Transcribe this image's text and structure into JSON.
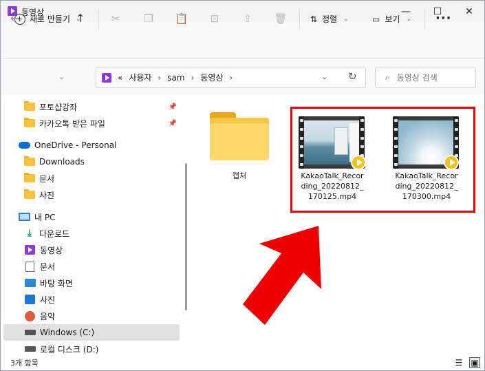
{
  "window": {
    "title": "동영상",
    "minimize_glyph": "—",
    "maximize_glyph": "☐",
    "close_glyph": "✕"
  },
  "toolbar": {
    "new_label": "새로 만들기",
    "chevron": "⌄",
    "cut_glyph": "✂",
    "copy_glyph": "❐",
    "paste_glyph": "📋",
    "rename_glyph": "⊡",
    "share_glyph": "⇪",
    "delete_glyph": "🗑",
    "sort_label": "정렬",
    "sort_glyph": "⇅",
    "view_label": "보기",
    "view_glyph": "▭",
    "more_glyph": "···"
  },
  "nav": {
    "back": "←",
    "forward": "→",
    "recent": "⌄",
    "up": "↑",
    "refresh": "↻",
    "addr_dropdown": "⌄"
  },
  "address": {
    "overflow": "«",
    "crumbs": [
      "사용자",
      "sam",
      "동영상"
    ],
    "sep": "›"
  },
  "search": {
    "placeholder": "동영상 검색",
    "icon_glyph": "⌕"
  },
  "sidebar": {
    "pinned": [
      {
        "label": "포토샵강좌",
        "pin": "📌"
      },
      {
        "label": "카카오톡 받은 파일",
        "pin": "📌"
      }
    ],
    "onedrive": {
      "label": "OneDrive - Personal"
    },
    "onedrive_items": [
      {
        "label": "Downloads"
      },
      {
        "label": "문서"
      },
      {
        "label": "사진"
      }
    ],
    "pc": {
      "label": "내 PC"
    },
    "pc_items": [
      {
        "label": "다운로드",
        "icon": "download-icon"
      },
      {
        "label": "동영상",
        "icon": "video-icon"
      },
      {
        "label": "문서",
        "icon": "document-icon"
      },
      {
        "label": "바탕 화면",
        "icon": "desktop-icon"
      },
      {
        "label": "사진",
        "icon": "picture-icon"
      },
      {
        "label": "음악",
        "icon": "music-icon"
      },
      {
        "label": "Windows (C:)",
        "icon": "drive-icon"
      },
      {
        "label": "로컬 디스크 (D:)",
        "icon": "drive-icon"
      }
    ],
    "download_glyph": "⤓"
  },
  "files": [
    {
      "name": "캡처",
      "type": "folder"
    },
    {
      "name_lines": [
        "KakaoTalk_Recor",
        "ding_20220812_",
        "170125.mp4"
      ],
      "type": "video"
    },
    {
      "name_lines": [
        "KakaoTalk_Recor",
        "ding_20220812_",
        "170300.mp4"
      ],
      "type": "video"
    }
  ],
  "status": {
    "count_text": "3개 항목",
    "details_glyph": "☰",
    "tiles_glyph": "▣"
  },
  "colors": {
    "highlight_box": "#e00000",
    "arrow": "#ee0000",
    "accent": "#8a3bd1"
  }
}
